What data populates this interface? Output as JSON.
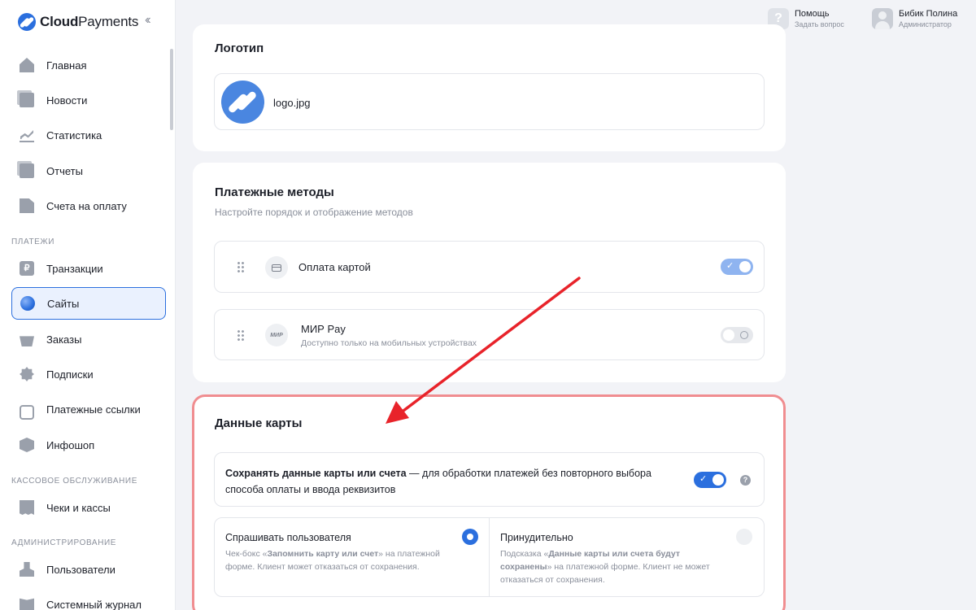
{
  "brand": {
    "name_bold": "Cloud",
    "name_rest": "Payments"
  },
  "sidebar": {
    "items": [
      {
        "label": "Главная"
      },
      {
        "label": "Новости"
      },
      {
        "label": "Статистика"
      },
      {
        "label": "Отчеты"
      },
      {
        "label": "Счета на оплату"
      }
    ],
    "sections": [
      {
        "title": "ПЛАТЕЖИ",
        "items": [
          {
            "label": "Транзакции"
          },
          {
            "label": "Сайты"
          },
          {
            "label": "Заказы"
          },
          {
            "label": "Подписки"
          },
          {
            "label": "Платежные ссылки"
          },
          {
            "label": "Инфошоп"
          }
        ]
      },
      {
        "title": "КАССОВОЕ ОБСЛУЖИВАНИЕ",
        "items": [
          {
            "label": "Чеки и кассы"
          }
        ]
      },
      {
        "title": "АДМИНИСТРИРОВАНИЕ",
        "items": [
          {
            "label": "Пользователи"
          },
          {
            "label": "Системный журнал"
          }
        ]
      }
    ],
    "active_item": "Сайты"
  },
  "header": {
    "help": {
      "title": "Помощь",
      "subtitle": "Задать вопрос"
    },
    "user": {
      "name": "Бибик Полина",
      "role": "Администратор"
    }
  },
  "logo_section": {
    "title": "Логотип",
    "filename": "logo.jpg"
  },
  "payment_methods": {
    "title": "Платежные методы",
    "subtitle": "Настройте порядок и отображение методов",
    "methods": [
      {
        "name": "Оплата картой",
        "note": "",
        "enabled": true
      },
      {
        "name": "МИР Pay",
        "note": "Доступно только на мобильных устройствах",
        "icon_text": "МИР",
        "enabled": false
      }
    ]
  },
  "card_data": {
    "title": "Данные карты",
    "save_option": {
      "bold": "Сохранять данные карты или счета",
      "rest": " — для обработки платежей без повторного выбора способа оплаты и ввода реквизитов",
      "enabled": true
    },
    "modes": [
      {
        "title": "Спрашивать пользователя",
        "desc_before": "Чек-бокс «",
        "desc_bold": "Запомнить карту или счет",
        "desc_after": "» на платежной форме. Клиент может отказаться от сохранения.",
        "selected": true
      },
      {
        "title": "Принудительно",
        "desc_before": "Подсказка «",
        "desc_bold": "Данные карты или счета будут сохранены",
        "desc_after": "» на платежной форме. Клиент не может отказаться от сохранения.",
        "selected": false
      }
    ]
  },
  "colors": {
    "accent": "#2b6fde",
    "highlight": "#f08d90",
    "arrow": "#e8232a"
  }
}
